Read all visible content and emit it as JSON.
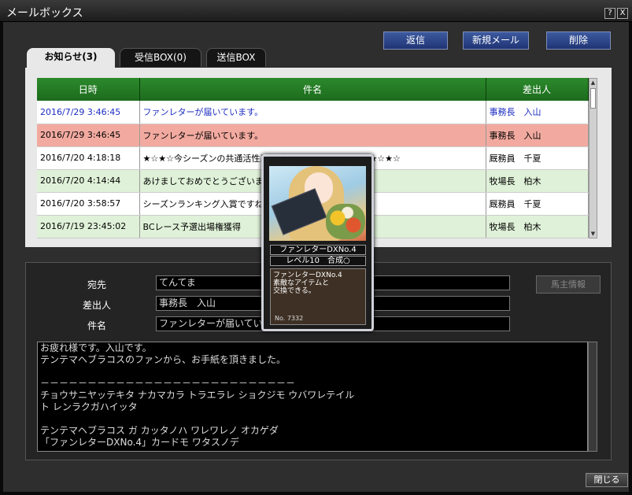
{
  "window": {
    "title": "メールボックス",
    "help_label": "?",
    "close_label": "X"
  },
  "actions": {
    "reply": "返信",
    "new_mail": "新規メール",
    "delete": "削除"
  },
  "tabs": [
    {
      "label": "お知らせ(3)",
      "active": true
    },
    {
      "label": "受信BOX(0)",
      "active": false
    },
    {
      "label": "送信BOX",
      "active": false
    }
  ],
  "table": {
    "headers": {
      "date": "日時",
      "subject": "件名",
      "sender": "差出人"
    },
    "rows": [
      {
        "date": "2016/7/29 3:46:45",
        "subject": "ファンレターが届いています。",
        "sender": "事務長　入山"
      },
      {
        "date": "2016/7/29 3:46:45",
        "subject": "ファンレターが届いています。",
        "sender": "事務長　入山"
      },
      {
        "date": "2016/7/20 4:18:18",
        "subject": "★☆★☆今シーズンの共通活性系統がわかっちゃいました♪★☆★☆",
        "sender": "厩務員　千夏"
      },
      {
        "date": "2016/7/20 4:14:44",
        "subject": "あけましておめでとうございます",
        "sender": "牧場長　柏木"
      },
      {
        "date": "2016/7/20 3:58:57",
        "subject": "シーズンランキング入賞ですね",
        "sender": "厩務員　千夏"
      },
      {
        "date": "2016/7/19 23:45:02",
        "subject": "BCレース予選出場権獲得",
        "sender": "牧場長　柏木"
      }
    ]
  },
  "detail": {
    "to_label": "宛先",
    "to_value": "てんてま",
    "from_label": "差出人",
    "from_value": "事務長　入山",
    "subject_label": "件名",
    "subject_value": "ファンレターが届いてい",
    "owner_info_button": "馬主情報",
    "body_lines": [
      "お疲れ様です。入山です。",
      "テンテマヘブラコスのファンから、お手紙を頂きました。",
      "",
      "－－－－－－－－－－－－－－－－－－－－－－－－－－－",
      "チョウサニヤッテキタ ナカマカラ トラエラレ ショクジモ ウバワレテイル",
      "ト レンラクガハイッタ",
      "",
      "テンテマヘブラコス ガ カッタノハ ワレワレノ オカゲダ",
      "「ファンレターDXNo.4」カードモ ワタスノデ"
    ]
  },
  "card_tooltip": {
    "name": "ファンレターDXNo.4",
    "level": "レベル10　合成○",
    "desc_lines": [
      "ファンレターDXNo.4",
      "素敵なアイテムと",
      "交換できる。"
    ],
    "number": "No. 7332"
  },
  "footer": {
    "close_label": "閉じる"
  }
}
